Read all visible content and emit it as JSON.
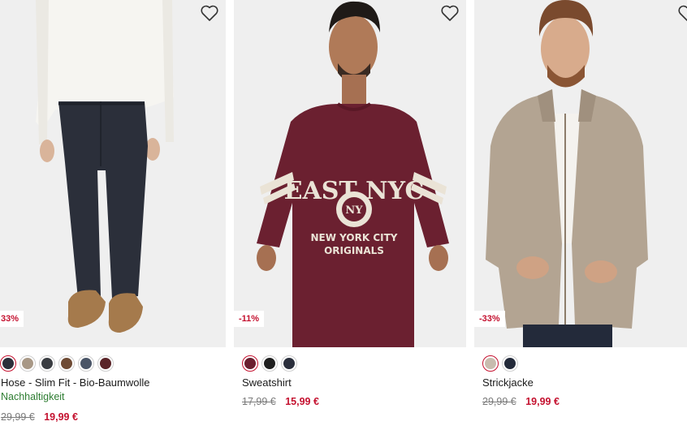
{
  "products": [
    {
      "badge": "33%",
      "name": "Hose - Slim Fit - Bio-Baumwolle",
      "sustainability": "Nachhaltigkeit",
      "old_price": "29,99 €",
      "new_price": "19,99 €",
      "swatches": [
        "#2b2f3a",
        "#a89886",
        "#3a3d42",
        "#6e4a34",
        "#4a5567",
        "#5a2428"
      ],
      "active_swatch": 0
    },
    {
      "badge": "-11%",
      "name": "Sweatshirt",
      "old_price": "17,99 €",
      "new_price": "15,99 €",
      "swatches": [
        "#6b2030",
        "#1f1f1f",
        "#2a2e3b"
      ],
      "active_swatch": 0,
      "print_lines": [
        "EAST NYC",
        "NEW YORK CITY",
        "ORIGINALS",
        "NY"
      ]
    },
    {
      "badge": "-33%",
      "name": "Strickjacke",
      "old_price": "29,99 €",
      "new_price": "19,99 €",
      "swatches": [
        "#c8bcae",
        "#232a3a"
      ],
      "active_swatch": 0
    }
  ],
  "colors": {
    "accent": "#c4112f",
    "sustainability": "#2e7d32",
    "old_price": "#7a7a7a"
  },
  "icons": {
    "wishlist": "heart-outline-icon"
  }
}
